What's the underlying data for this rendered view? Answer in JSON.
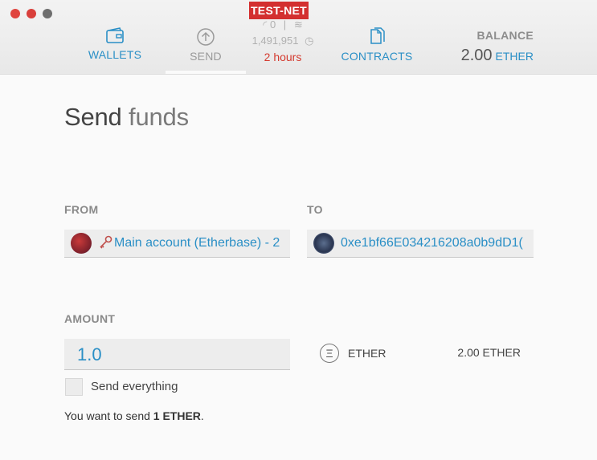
{
  "window": {
    "network_badge": "TEST-NET"
  },
  "nav": {
    "wallets_label": "WALLETS",
    "send_label": "SEND",
    "contracts_label": "CONTRACTS"
  },
  "network": {
    "peers": "0",
    "block_number": "1,491,951",
    "last_block_age": "2 hours"
  },
  "balance": {
    "label": "BALANCE",
    "amount": "2.00",
    "unit": "ETHER"
  },
  "page": {
    "title_bold": "Send",
    "title_light": "funds"
  },
  "form": {
    "from_label": "FROM",
    "from_account": "Main account (Etherbase) - 2",
    "to_label": "TO",
    "to_address": "0xe1bf66E034216208a0b9dD1(",
    "amount_label": "AMOUNT",
    "amount_value": "1.0",
    "currency_symbol": "Ξ",
    "currency": "ETHER",
    "available_balance": "2.00 ETHER",
    "send_everything_label": "Send everything",
    "send_everything_checked": false,
    "summary_prefix": "You want to send ",
    "summary_amount": "1 ETHER",
    "summary_suffix": "."
  },
  "colors": {
    "accent": "#2a8fc6",
    "testnet_badge": "#d32f2f",
    "warning_text": "#d43a2f"
  }
}
